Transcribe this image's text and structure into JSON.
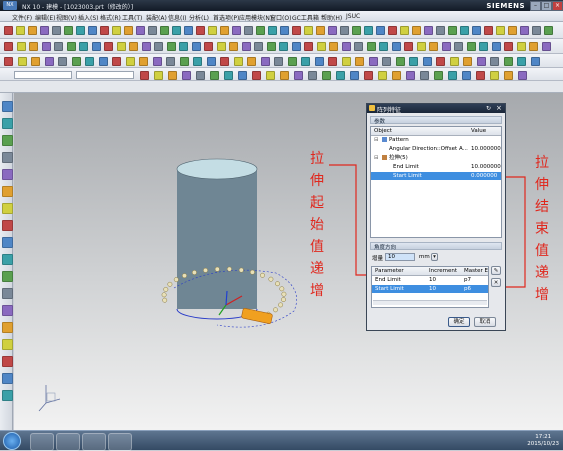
{
  "window": {
    "title": "NX 10 - 建模 - [1023003.prt（修改的）]",
    "brand": "SIEMENS",
    "logo": "NX",
    "controls": [
      "minimize-icon",
      "restore-icon",
      "close-icon"
    ]
  },
  "menu": [
    "文件(F)",
    "编辑(E)",
    "视图(V)",
    "插入(S)",
    "格式(R)",
    "工具(T)",
    "装配(A)",
    "信息(I)",
    "分析(L)",
    "首选项(P)",
    "应用模块(N)",
    "窗口(O)",
    "GC工具箱",
    "帮助(H)",
    "JSUC"
  ],
  "dialog": {
    "title": "阵列特征",
    "section1": "参数",
    "tree_header": [
      "Object",
      "Value"
    ],
    "tree_rows": [
      {
        "label": "Pattern",
        "value": ""
      },
      {
        "label": "Angular Direction::Offset A...",
        "value": "10.000000"
      },
      {
        "label": "拉伸(5)",
        "value": ""
      },
      {
        "label": "End Limit",
        "value": "10.000000"
      },
      {
        "label": "Start Limit",
        "value": "0.000000"
      }
    ],
    "section2": "角度方向",
    "step_label": "增量",
    "step_value": "10",
    "unit": "mm",
    "table_header": [
      "Parameter",
      "Increment",
      "Master E"
    ],
    "table_rows": [
      {
        "param": "End Limit",
        "inc": "10",
        "master": "p7"
      },
      {
        "param": "Start Limit",
        "inc": "10",
        "master": "p6"
      }
    ],
    "ok": "确定",
    "cancel": "取消"
  },
  "annotations": {
    "left": [
      "拉",
      "伸",
      "起",
      "始",
      "值",
      "递",
      "增"
    ],
    "right": [
      "拉",
      "伸",
      "结",
      "束",
      "值",
      "递",
      "增"
    ],
    "color": "#e0281e"
  },
  "taskbar": {
    "time": "17:21",
    "date": "2015/10/23"
  },
  "colors": {
    "selection": "#3e8ee0",
    "cylinder": "#6f8694",
    "handle": "#f0a020"
  }
}
